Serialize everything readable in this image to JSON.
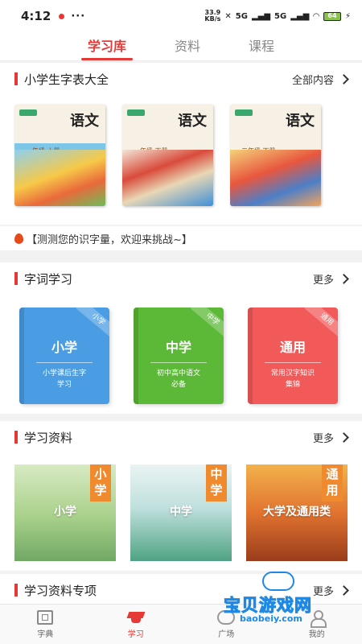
{
  "status": {
    "time": "4:12",
    "speed_top": "33.9",
    "speed_bottom": "KB/s",
    "net1": "5G",
    "net2": "5G",
    "battery": "64"
  },
  "tabs": [
    {
      "label": "学习库"
    },
    {
      "label": "资料"
    },
    {
      "label": "课程"
    }
  ],
  "charts_section": {
    "title": "小学生字表大全",
    "more": "全部内容"
  },
  "textbooks": [
    {
      "title": "语文",
      "grade": "一年级 上册"
    },
    {
      "title": "语文",
      "grade": "一年级 下册"
    },
    {
      "title": "语文",
      "grade": "二年级 下册"
    }
  ],
  "challenge": {
    "text": "【测测您的识字量，欢迎来挑战~】"
  },
  "vocab_section": {
    "title": "字词学习",
    "more": "更多"
  },
  "vocab_books": [
    {
      "name": "小学",
      "corner": "小学",
      "desc1": "小学课后生字",
      "desc2": "学习",
      "color": "#4a9de3"
    },
    {
      "name": "中学",
      "corner": "中学",
      "desc1": "初中高中语文",
      "desc2": "必备",
      "color": "#5cb837"
    },
    {
      "name": "通用",
      "corner": "通用",
      "desc1": "常用汉字知识",
      "desc2": "集锦",
      "color": "#f25a5a"
    }
  ],
  "materials_section": {
    "title": "学习资料",
    "more": "更多"
  },
  "materials": [
    {
      "vlabel": "小学",
      "clabel": "小学"
    },
    {
      "vlabel": "中学",
      "clabel": "中学"
    },
    {
      "vlabel": "通用",
      "clabel": "大学及通用类"
    }
  ],
  "special_section": {
    "title": "学习资料专项",
    "more": "更多"
  },
  "bottom_nav": [
    {
      "label": "字典"
    },
    {
      "label": "学习"
    },
    {
      "label": "广场"
    },
    {
      "label": "我的"
    }
  ],
  "watermark": {
    "main": "宝贝游戏网",
    "url": "baobeiy.com"
  }
}
